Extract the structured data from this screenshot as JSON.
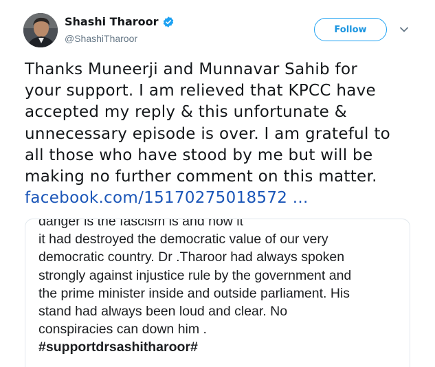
{
  "user": {
    "display_name": "Shashi Tharoor",
    "handle": "@ShashiTharoor",
    "verified": true,
    "verified_icon": "verified-badge-icon"
  },
  "actions": {
    "follow_label": "Follow",
    "caret_icon": "chevron-down-icon"
  },
  "tweet": {
    "lines": [
      "Thanks Muneerji and Munnavar Sahib for",
      "your support. I am relieved that KPCC have",
      "accepted my reply & this unfortunate &",
      "unnecessary episode is over. I am grateful to",
      "all those who have stood by me but will be",
      "making no further comment on this matter."
    ],
    "link": "facebook.com/15170275018572 ..."
  },
  "card": {
    "lines": [
      "danger is the fascism is and how it",
      "it had destroyed the democratic value of our very",
      "democratic country.  Dr .Tharoor had always spoken",
      "strongly against injustice rule by the government and",
      "the prime minister inside and outside parliament. His",
      "stand had always been loud and clear. No",
      "conspiracies can down him ."
    ],
    "hashtag": "#supportdrsashitharoor#"
  },
  "colors": {
    "link_blue": "#1b56b8",
    "follow_blue": "#1da1f2",
    "handle_gray": "#657786",
    "border": "#e1e8ed"
  }
}
